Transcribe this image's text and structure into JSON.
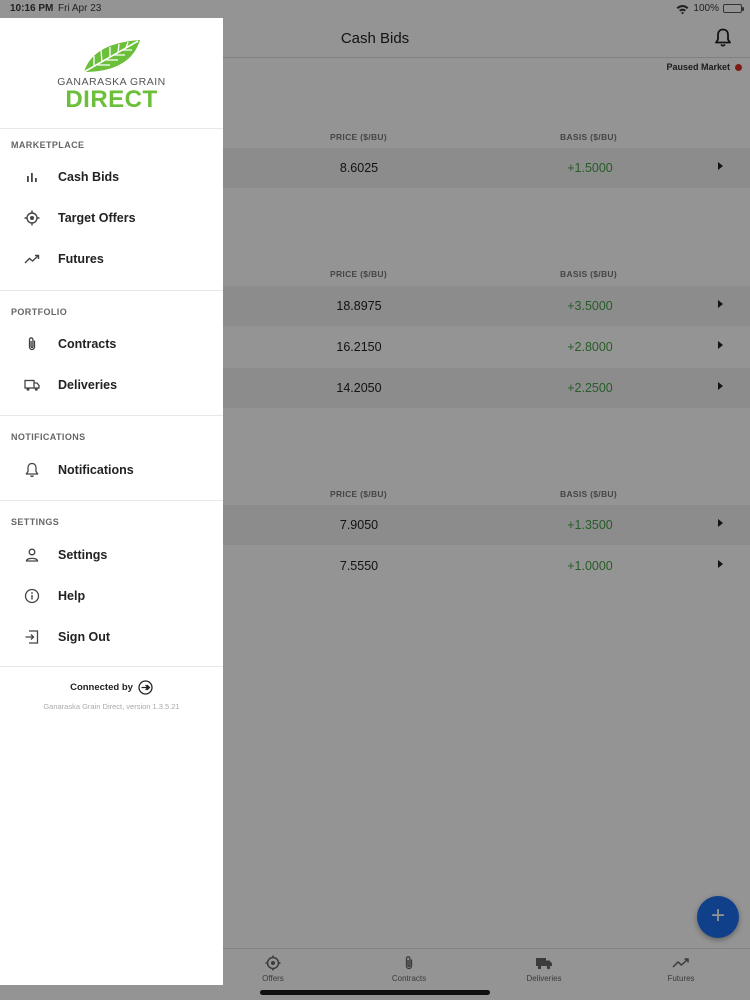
{
  "status_bar": {
    "time": "10:16 PM",
    "date": "Fri Apr 23",
    "battery": "100%"
  },
  "header": {
    "title": "Cash Bids"
  },
  "market_status": {
    "label": "Paused Market",
    "color": "#d93025"
  },
  "sections": [
    {
      "columns": [
        "PRICE ($/BU)",
        "BASIS ($/BU)"
      ],
      "rows": [
        {
          "price": "8.6025",
          "basis": "+1.5000"
        }
      ]
    },
    {
      "columns": [
        "PRICE ($/BU)",
        "BASIS ($/BU)"
      ],
      "rows": [
        {
          "price": "18.8975",
          "basis": "+3.5000"
        },
        {
          "price": "16.2150",
          "basis": "+2.8000"
        },
        {
          "price": "14.2050",
          "basis": "+2.2500"
        }
      ]
    },
    {
      "columns": [
        "PRICE ($/BU)",
        "BASIS ($/BU)"
      ],
      "rows": [
        {
          "price": "7.9050",
          "basis": "+1.3500"
        },
        {
          "price": "7.5550",
          "basis": "+1.0000"
        }
      ]
    }
  ],
  "tabbar": [
    {
      "label": "Offers",
      "icon": "target-icon"
    },
    {
      "label": "Contracts",
      "icon": "paperclip-icon"
    },
    {
      "label": "Deliveries",
      "icon": "truck-icon"
    },
    {
      "label": "Futures",
      "icon": "trend-icon"
    }
  ],
  "drawer": {
    "brand_top": "GANARASKA GRAIN",
    "brand_main": "DIRECT",
    "brand_color": "#6cbf3a",
    "groups": {
      "marketplace": "MARKETPLACE",
      "portfolio": "PORTFOLIO",
      "notifications": "NOTIFICATIONS",
      "settings": "SETTINGS"
    },
    "items": {
      "cash_bids": "Cash Bids",
      "target_offers": "Target Offers",
      "futures": "Futures",
      "contracts": "Contracts",
      "deliveries": "Deliveries",
      "notifications": "Notifications",
      "settings": "Settings",
      "help": "Help",
      "sign_out": "Sign Out"
    },
    "connected_by": "Connected by",
    "version": "Ganaraska Grain Direct, version 1.3.5.21"
  },
  "fab": {
    "label": "+"
  }
}
